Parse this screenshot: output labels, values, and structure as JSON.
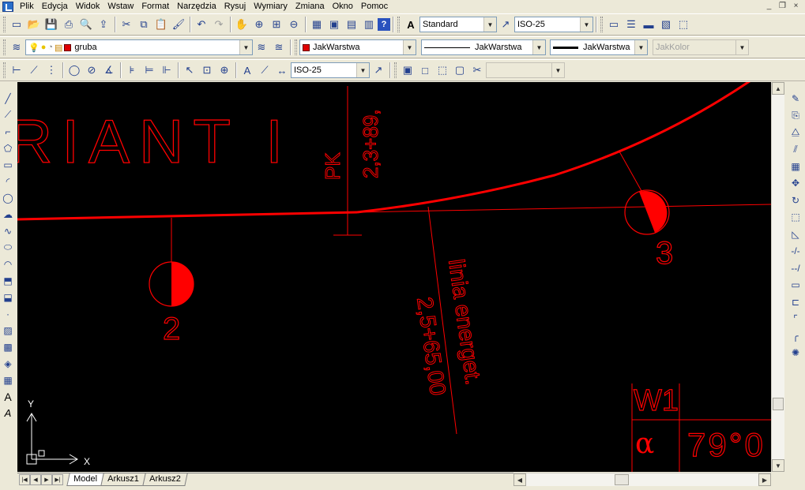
{
  "menu": {
    "items": [
      "Plik",
      "Edycja",
      "Widok",
      "Wstaw",
      "Format",
      "Narzędzia",
      "Rysuj",
      "Wymiary",
      "Zmiana",
      "Okno",
      "Pomoc"
    ]
  },
  "window_controls": {
    "minimize": "_",
    "restore": "❐",
    "close": "×"
  },
  "toolbar1": {
    "text_style": "Standard",
    "dim_style": "ISO-25"
  },
  "toolbar2": {
    "layer": "gruba",
    "color": "JakWarstwa",
    "linetype": "JakWarstwa",
    "lineweight": "JakWarstwa",
    "plotstyle": "JakKolor",
    "accent_color": "#e00000"
  },
  "toolbar3": {
    "dim_style": "ISO-25",
    "empty_combo": ""
  },
  "drawing": {
    "variant_title": "RIANT I",
    "pk_label": "PK",
    "pk_value": "2,3+89,",
    "line_label_1": "linia energet.",
    "line_label_2": "2,5+65,00",
    "marker_2": "2",
    "marker_3": "3",
    "table_w": "W1",
    "table_alpha": "α",
    "table_angle": "79°0",
    "ucs_x": "X",
    "ucs_y": "Y",
    "line_color": "#ff0000"
  },
  "tabs": {
    "items": [
      "Model",
      "Arkusz1",
      "Arkusz2"
    ],
    "active": "Model"
  }
}
